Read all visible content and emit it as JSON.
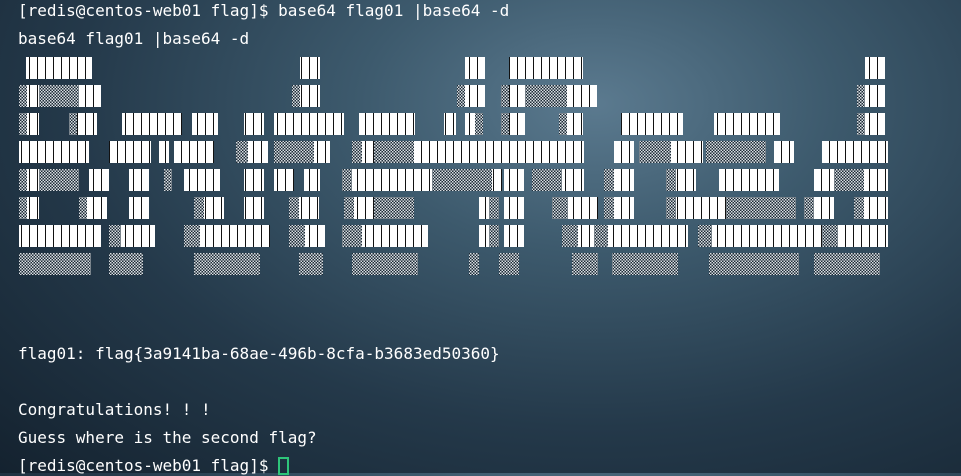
{
  "terminal": {
    "prompt_user": "[redis@centos-web01 flag]$",
    "command": "base64 flag01 |base64 -d",
    "echo": "base64 flag01 |base64 -d",
    "flag_line": "flag01: flag{3a9141ba-68ae-496b-8cfa-b3683ed50360}",
    "congrats": "Congratulations! ! !",
    "hint": "Guess where is the second flag?",
    "prompt_end": "[redis@centos-web01 flag]$"
  },
  "art": {
    "rows": [
      "  XXXXXX                            XX                    XX   XXXXXXX                               XX  ",
      "  XXXXX                            XX                    X X  XXXXXX                                XX  ",
      "  X     XX  XXXXXX XX   XX XXXXXX  XXXX    X  X X   X     XXXXXX   XXXXXX            XX  ",
      " XXXXXXX  XXXXXXXXX   XXXXXXXX  XXXXXXX XXXXXXXXXXXXXXXXX  XXXXXXXX XXXXXXXX  XXXXXXX ",
      " XXXXXX XX XX X  XX  XX  XX  XXXXXXXXXXXXXXXXXX XX XXXXX  XX   XX   XXXXXXXX XXXXXX  ",
      " X   X XX   XX  XX  XX  XXXXXX    X X   XXX XXX  XX  XX XXXXXXXXX  XXX XX  ",
      " XXXXXXXX XXX   XXXXXXX   XXX XXXXXXXX    X X     XXXXXXXXXXXXX XXXXXXXXXXXXXXXXXXX ",
      " XXXXXXX  XXX      XXXXXXX     XXX    XXXXXXX        X   XX       XX    XXXXXXX     XXXXXX    XXXXXXX  "
    ]
  }
}
